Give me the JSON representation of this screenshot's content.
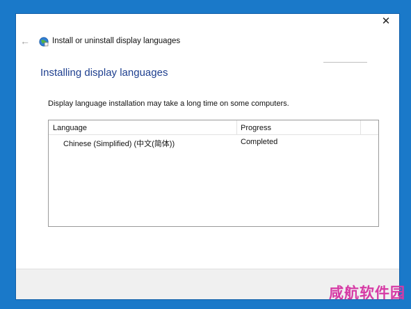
{
  "window": {
    "close_glyph": "✕",
    "back_glyph": "←",
    "title": "Install or uninstall display languages"
  },
  "page": {
    "heading": "Installing display languages",
    "description": "Display language installation may take a long time on some computers."
  },
  "table": {
    "columns": [
      "Language",
      "Progress"
    ],
    "rows": [
      {
        "language": "Chinese (Simplified) (中文(简体))",
        "progress": "Completed"
      }
    ]
  },
  "watermark": "咸航软件园",
  "colors": {
    "desktop": "#1a79c9",
    "heading": "#1e3f8f",
    "watermark": "#d63aa5"
  }
}
